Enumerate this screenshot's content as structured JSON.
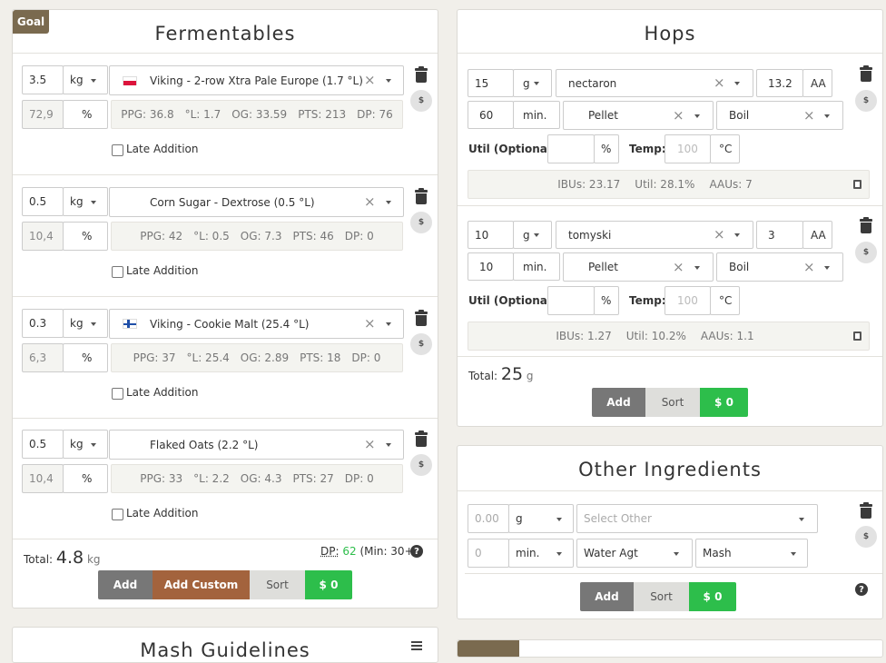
{
  "fermentables": {
    "title": "Fermentables",
    "goal_tab": "Goal",
    "items": [
      {
        "amount": "3.5",
        "unit": "kg",
        "name": "Viking - 2-row Xtra Pale Europe (1.7 °L)",
        "pct": "72,9",
        "pct_unit": "%",
        "ppg": "PPG: 36.8",
        "lov": "°L: 1.7",
        "og": "OG: 33.59",
        "pts": "PTS: 213",
        "dp": "DP: 76",
        "late": "Late Addition",
        "flag": "poland"
      },
      {
        "amount": "0.5",
        "unit": "kg",
        "name": "Corn Sugar - Dextrose (0.5 °L)",
        "pct": "10,4",
        "pct_unit": "%",
        "ppg": "PPG: 42",
        "lov": "°L: 0.5",
        "og": "OG: 7.3",
        "pts": "PTS: 46",
        "dp": "DP: 0",
        "late": "Late Addition",
        "flag": ""
      },
      {
        "amount": "0.3",
        "unit": "kg",
        "name": "Viking - Cookie Malt (25.4 °L)",
        "pct": "6,3",
        "pct_unit": "%",
        "ppg": "PPG: 37",
        "lov": "°L: 25.4",
        "og": "OG: 2.89",
        "pts": "PTS: 18",
        "dp": "DP: 0",
        "late": "Late Addition",
        "flag": "finland"
      },
      {
        "amount": "0.5",
        "unit": "kg",
        "name": "Flaked Oats (2.2 °L)",
        "pct": "10,4",
        "pct_unit": "%",
        "ppg": "PPG: 33",
        "lov": "°L: 2.2",
        "og": "OG: 4.3",
        "pts": "PTS: 27",
        "dp": "DP: 0",
        "late": "Late Addition",
        "flag": ""
      }
    ],
    "total_label": "Total:",
    "total_value": "4.8",
    "total_unit": "kg",
    "dp_label": "DP:",
    "dp_value": "62",
    "dp_min": "(Min: 30+)",
    "buttons": {
      "add": "Add",
      "add_custom": "Add Custom",
      "sort": "Sort",
      "cost": "$ 0"
    },
    "dollar": "$"
  },
  "hops": {
    "title": "Hops",
    "items": [
      {
        "amount": "15",
        "unit": "g",
        "name": "nectaron",
        "aa": "13.2",
        "aa_label": "AA",
        "time": "60",
        "time_unit": "min.",
        "form": "Pellet",
        "use": "Boil",
        "util_label": "Util (Optional):",
        "util_unit": "%",
        "temp_label": "Temp:",
        "temp_placeholder": "100",
        "temp_unit": "°C",
        "ibus": "IBUs: 23.17",
        "util": "Util: 28.1%",
        "aaus": "AAUs: 7"
      },
      {
        "amount": "10",
        "unit": "g",
        "name": "tomyski",
        "aa": "3",
        "aa_label": "AA",
        "time": "10",
        "time_unit": "min.",
        "form": "Pellet",
        "use": "Boil",
        "util_label": "Util (Optional):",
        "util_unit": "%",
        "temp_label": "Temp:",
        "temp_placeholder": "100",
        "temp_unit": "°C",
        "ibus": "IBUs: 1.27",
        "util": "Util: 10.2%",
        "aaus": "AAUs: 1.1"
      }
    ],
    "total_label": "Total:",
    "total_value": "25",
    "total_unit": "g",
    "buttons": {
      "add": "Add",
      "sort": "Sort",
      "cost": "$ 0"
    },
    "dollar": "$"
  },
  "other": {
    "title": "Other Ingredients",
    "amount_placeholder": "0.00",
    "unit": "g",
    "select_placeholder": "Select Other",
    "time_placeholder": "0",
    "time_unit": "min.",
    "type": "Water Agt",
    "use": "Mash",
    "buttons": {
      "add": "Add",
      "sort": "Sort",
      "cost": "$ 0"
    },
    "dollar": "$"
  },
  "mash": {
    "title": "Mash Guidelines"
  }
}
